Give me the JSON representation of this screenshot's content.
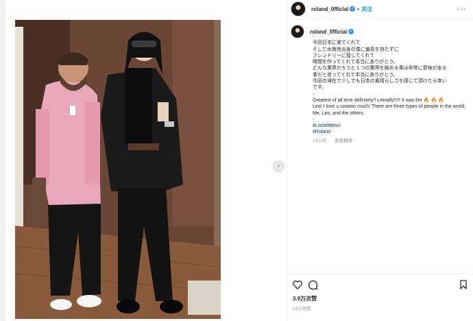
{
  "post": {
    "username": "roland_0fficial",
    "follow_label": "关注",
    "more_label": "···",
    "caption_lines": [
      "-",
      "今回日本に来てくれて",
      "そして水商売出身の僕に偏見を持たずに",
      "フレンドリーに接してくれて",
      "時間を作ってくれて本当にありがとう。",
      "どんな業界だろうと１つの業界を極める事は非常に意味がある",
      "事だと言ってくれて本当にありがとう。",
      "今回の滞在で少しでも日本の素晴らしさを感じて頂けたら幸い",
      "です。",
      "-"
    ],
    "caption_en": "Greatest of all time definitely!! Literally!!!!! It was fire 🔥 🔥 🔥",
    "caption_en2": "Leo! I love u sooooo much! There are three types of people in the world. Me, Leo, and the others.",
    "caption_dash": "-",
    "hashtags": [
      "#LionelMessi",
      "#Roland"
    ],
    "caption_time": "13小时",
    "translate_label": "查看翻译",
    "likes": "3.9万次赞",
    "timestamp": "13小时前"
  },
  "icons": {
    "like": "heart-icon",
    "comment": "comment-icon",
    "save": "bookmark-icon",
    "verified": "verified-badge-icon",
    "next": "chevron-right-icon"
  },
  "colors": {
    "link_blue": "#0095f6",
    "hashtag_blue": "#00376b",
    "verified_blue": "#3897f0",
    "muted_gray": "#8e8e8e"
  }
}
